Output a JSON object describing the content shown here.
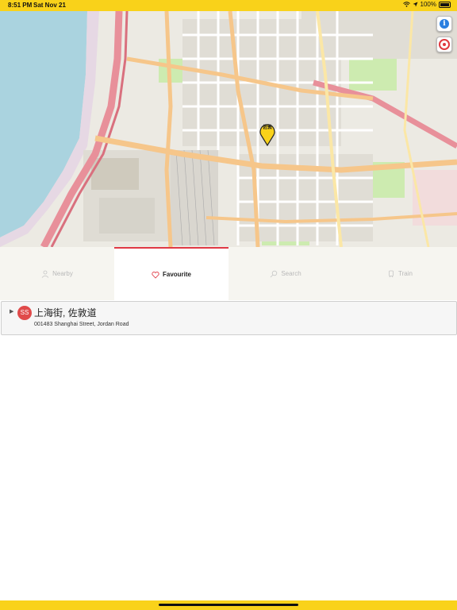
{
  "status_bar": {
    "time": "8:51 PM",
    "date": "Sat Nov 21",
    "battery": "100%"
  },
  "map": {
    "pin_label": "佐敦",
    "buttons": {
      "info": "i"
    }
  },
  "tabs": [
    {
      "label": "Nearby",
      "icon": "person-icon",
      "active": false
    },
    {
      "label": "Favourite",
      "icon": "heart-icon",
      "active": true
    },
    {
      "label": "Search",
      "icon": "search-icon",
      "active": false
    },
    {
      "label": "Train",
      "icon": "train-icon",
      "active": false
    }
  ],
  "favourites": [
    {
      "badge": "SS",
      "name": "上海街, 佐敦道",
      "detail": "001483 Shanghai Street, Jordan Road"
    }
  ],
  "colors": {
    "accent_yellow": "#f9d21a",
    "accent_red": "#e03a45",
    "badge_red": "#e04a4a",
    "water": "#aad3df"
  }
}
